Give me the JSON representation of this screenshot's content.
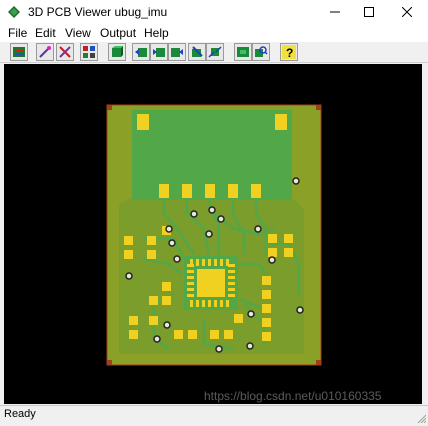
{
  "window": {
    "title": "3D PCB Viewer  ubug_imu",
    "app_icon": "pcb-viewer-icon",
    "controls": [
      "minimize-icon",
      "maximize-icon",
      "close-icon"
    ]
  },
  "menu": {
    "items": [
      {
        "label": "File"
      },
      {
        "label": "Edit"
      },
      {
        "label": "View"
      },
      {
        "label": "Output"
      },
      {
        "label": "Help"
      }
    ]
  },
  "toolbar": {
    "buttons": [
      {
        "icon": "board-icon"
      },
      {
        "icon": "magic-wand-icon"
      },
      {
        "icon": "settings-x-icon"
      },
      {
        "icon": "layers-icon"
      },
      {
        "icon": "view-3d-icon"
      },
      {
        "icon": "rotate-left-icon"
      },
      {
        "icon": "rotate-right-icon"
      },
      {
        "icon": "flip-view-icon"
      },
      {
        "icon": "tool-icon"
      },
      {
        "icon": "move-icon"
      },
      {
        "icon": "front-view-icon"
      },
      {
        "icon": "zoom-in-icon"
      },
      {
        "icon": "help-icon"
      }
    ]
  },
  "viewport": {
    "board_color": "#8aa026",
    "board_edge_color": "#a0401a",
    "copper_color": "#5fa84a",
    "pad_color": "#f0d020",
    "background": "#000000"
  },
  "status": {
    "text": "Ready",
    "watermark": "https://blog.csdn.net/u010160335"
  }
}
